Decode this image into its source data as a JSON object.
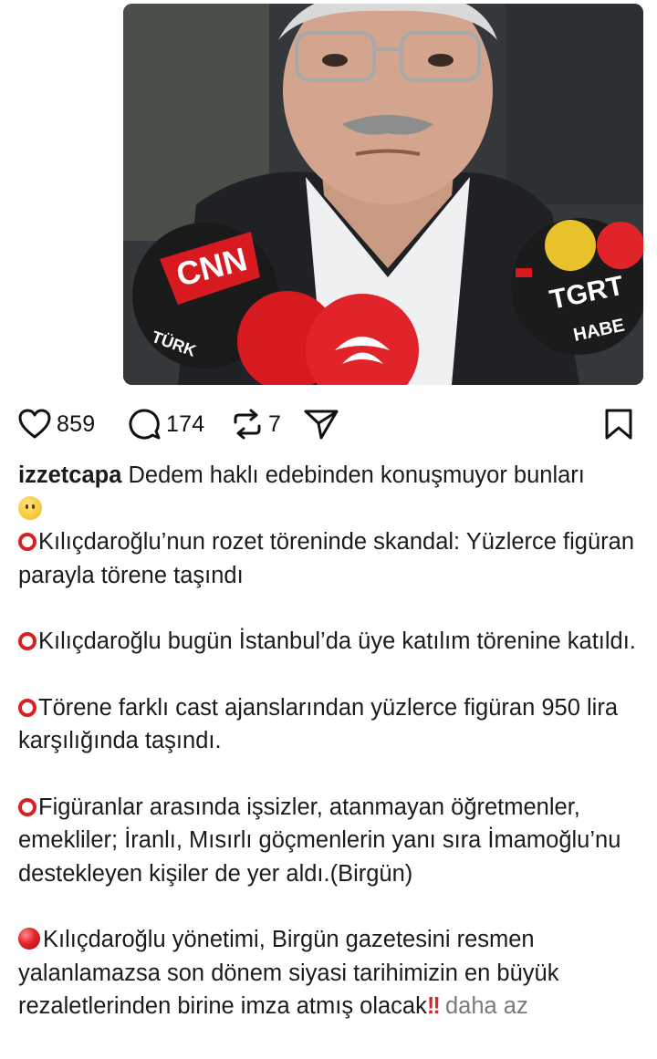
{
  "post": {
    "image_alt_badges": [
      "CNN TÜRK",
      "TGRT HABER"
    ],
    "actions": {
      "likes": "859",
      "comments": "174",
      "reposts": "7"
    },
    "caption": {
      "username": "izzetcapa",
      "headline": "Dedem haklı edebinden konuşmuyor bunları",
      "p1": "Kılıçdaroğlu’nun rozet töreninde skandal: Yüzlerce figüran parayla törene taşındı",
      "p2": "Kılıçdaroğlu bugün İstanbul’da üye katılım törenine katıldı.",
      "p3": "Törene farklı cast ajanslarından yüzlerce figüran 950 lira karşılığında taşındı.",
      "p4": "Figüranlar arasında işsizler, atanmayan öğretmenler, emekliler; İranlı, Mısırlı göçmenlerin yanı sıra İmamoğlu’nu destekleyen kişiler de yer aldı.(Birgün)",
      "p5": "Kılıçdaroğlu yönetimi, Birgün gazetesini resmen yalanlamazsa son dönem siyasi tarihimizin en büyük rezaletlerinden birine imza atmış olacak",
      "more_label": "daha az"
    }
  },
  "colors": {
    "accent_red": "#d92020",
    "muted_text": "#7a7a7a"
  }
}
